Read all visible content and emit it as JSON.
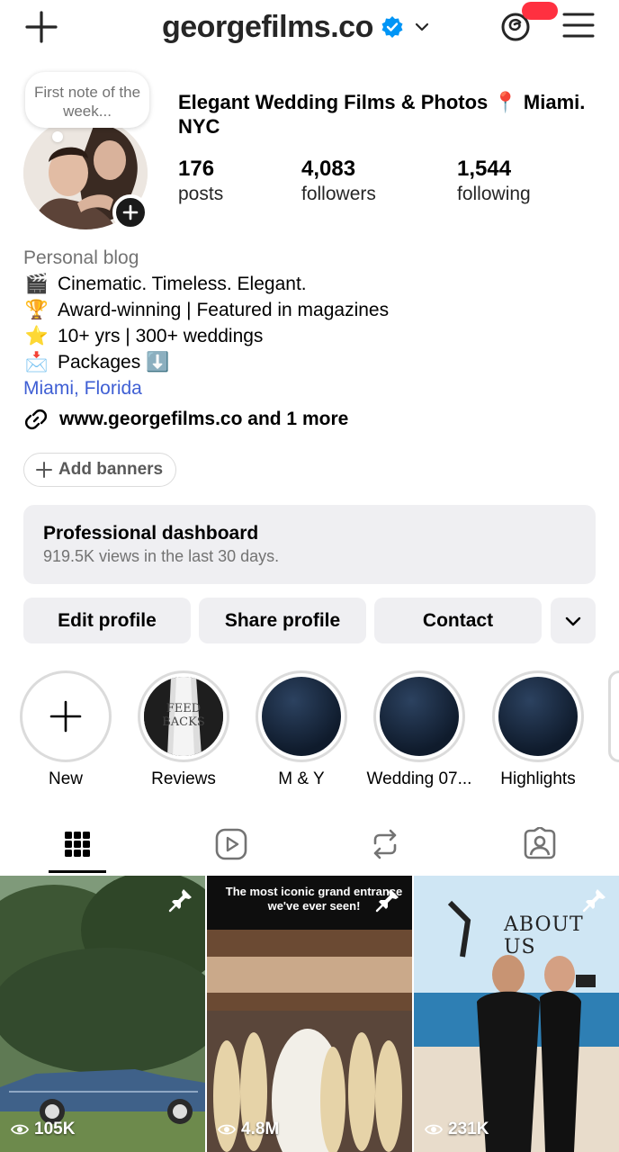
{
  "header": {
    "username": "georgefilms.co",
    "threads_badge": ""
  },
  "profile": {
    "note": "First note of the week...",
    "display_name": "Elegant Wedding Films & Photos 📍 Miami. NYC",
    "stats": [
      {
        "value": "176",
        "label": "posts"
      },
      {
        "value": "4,083",
        "label": "followers"
      },
      {
        "value": "1,544",
        "label": "following"
      }
    ]
  },
  "bio": {
    "category": "Personal blog",
    "lines": [
      {
        "emoji": "🎬",
        "text": "Cinematic. Timeless. Elegant."
      },
      {
        "emoji": "🏆",
        "text": "Award-winning | Featured in magazines"
      },
      {
        "emoji": "⭐",
        "text": "10+ yrs | 300+ weddings"
      },
      {
        "emoji": "📩",
        "text": "Packages ⬇️"
      }
    ],
    "location": "Miami, Florida",
    "link": "www.georgefilms.co and 1 more",
    "add_banners": "Add banners"
  },
  "dashboard": {
    "title": "Professional dashboard",
    "subtitle": "919.5K views in the last 30 days."
  },
  "actions": {
    "edit": "Edit profile",
    "share": "Share profile",
    "contact": "Contact"
  },
  "highlights": [
    {
      "label": "New"
    },
    {
      "label": "Reviews",
      "cover_text": "FEED BACKS"
    },
    {
      "label": "M & Y"
    },
    {
      "label": "Wedding 07..."
    },
    {
      "label": "Highlights"
    }
  ],
  "tabs": [
    "grid-icon",
    "reels-icon",
    "reposts-icon",
    "tagged-icon"
  ],
  "posts": [
    {
      "views": "105K",
      "pinned": true
    },
    {
      "views": "4.8M",
      "pinned": true,
      "caption": "The most iconic grand entrance we've ever seen!"
    },
    {
      "views": "231K",
      "pinned": true,
      "overlay_text": "ABOUT US"
    }
  ],
  "colors": {
    "link_blue": "#3f5fd4",
    "verified_blue": "#0095f6",
    "badge_red": "#ff3040",
    "button_bg": "#efeff2"
  }
}
